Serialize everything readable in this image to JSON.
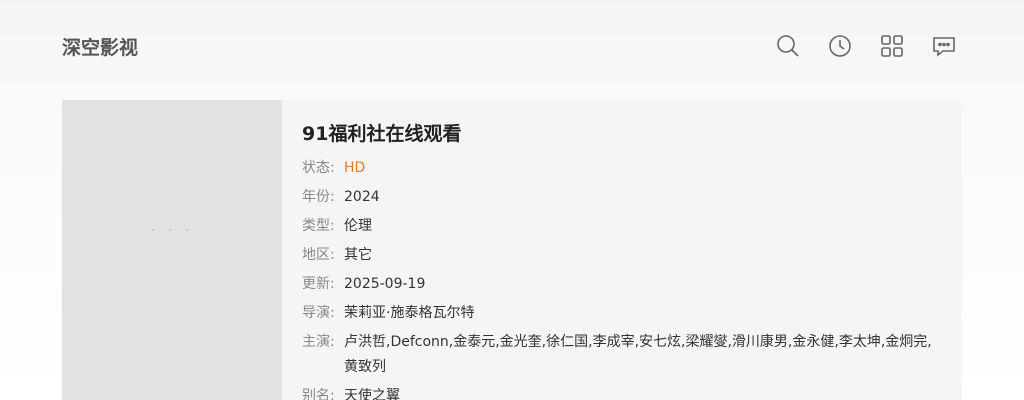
{
  "header": {
    "logo": "深空影视",
    "icons": [
      "search-icon",
      "history-icon",
      "grid-icon",
      "message-icon"
    ]
  },
  "poster": {
    "placeholder": "· · ·"
  },
  "detail": {
    "title": "91福利社在线观看",
    "rows": [
      {
        "label": "状态:",
        "value": "HD"
      },
      {
        "label": "年份:",
        "value": "2024"
      },
      {
        "label": "类型:",
        "value": "伦理"
      },
      {
        "label": "地区:",
        "value": "其它"
      },
      {
        "label": "更新:",
        "value": "2025-09-19"
      },
      {
        "label": "导演:",
        "value": "茉莉亚·施泰格瓦尔特"
      },
      {
        "label": "主演:",
        "value": "卢洪哲,Defconn,金泰元,金光奎,徐仁国,李成宰,安七炫,梁耀燮,滑川康男,金永健,李太坤,金炯完,黄致列"
      },
      {
        "label": "别名:",
        "value": "天使之翼"
      }
    ]
  },
  "colors": {
    "status": "#e27a26",
    "poster_bg": "#e2e2e2",
    "card_bg": "#f5f5f5"
  }
}
